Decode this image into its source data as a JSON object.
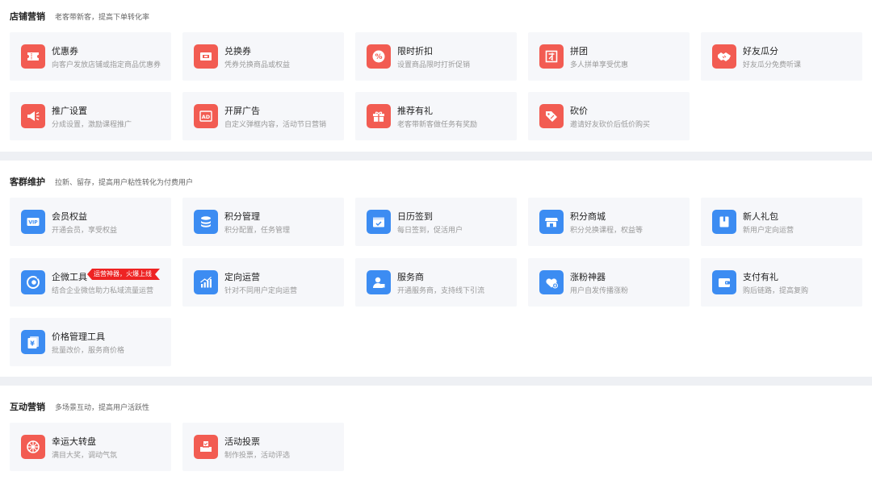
{
  "sections": [
    {
      "title": "店铺营销",
      "desc": "老客带新客，提高下单转化率",
      "cards": [
        {
          "title": "优惠券",
          "desc": "向客户发放店铺或指定商品优惠券",
          "icon": "coupon-icon",
          "color": "#f25c52"
        },
        {
          "title": "兑换券",
          "desc": "凭券兑换商品或权益",
          "icon": "exchange-ticket-icon",
          "color": "#f25c52"
        },
        {
          "title": "限时折扣",
          "desc": "设置商品限时打折促销",
          "icon": "percent-discount-icon",
          "color": "#f25c52"
        },
        {
          "title": "拼团",
          "desc": "多人拼单享受优惠",
          "icon": "group-buy-icon",
          "color": "#f25c52"
        },
        {
          "title": "好友瓜分",
          "desc": "好友瓜分免费听课",
          "icon": "handshake-icon",
          "color": "#f25c52"
        },
        {
          "title": "推广设置",
          "desc": "分成设置，激励课程推广",
          "icon": "megaphone-icon",
          "color": "#f25c52"
        },
        {
          "title": "开屏广告",
          "desc": "自定义弹框内容，活动节日营销",
          "icon": "ad-icon",
          "color": "#f25c52"
        },
        {
          "title": "推荐有礼",
          "desc": "老客带新客做任务有奖励",
          "icon": "gift-icon",
          "color": "#f25c52"
        },
        {
          "title": "砍价",
          "desc": "邀请好友砍价后低价购买",
          "icon": "price-tag-icon",
          "color": "#f25c52"
        }
      ]
    },
    {
      "title": "客群维护",
      "desc": "拉新、留存，提高用户粘性转化为付费用户",
      "cards": [
        {
          "title": "会员权益",
          "desc": "开通会员，享受权益",
          "icon": "vip-card-icon",
          "color": "#3c8cf2"
        },
        {
          "title": "积分管理",
          "desc": "积分配置，任务管理",
          "icon": "coin-stack-icon",
          "color": "#3c8cf2"
        },
        {
          "title": "日历签到",
          "desc": "每日签到，促活用户",
          "icon": "calendar-check-icon",
          "color": "#3c8cf2"
        },
        {
          "title": "积分商城",
          "desc": "积分兑换课程，权益等",
          "icon": "store-icon",
          "color": "#3c8cf2"
        },
        {
          "title": "新人礼包",
          "desc": "新用户定向运营",
          "icon": "gift-pack-icon",
          "color": "#3c8cf2"
        },
        {
          "title": "企微工具",
          "desc": "结合企业微信助力私域流量运营",
          "icon": "wecom-icon",
          "color": "#3c8cf2",
          "badge": "运营神器，火爆上线"
        },
        {
          "title": "定向运营",
          "desc": "针对不同用户定向运营",
          "icon": "growth-chart-icon",
          "color": "#3c8cf2"
        },
        {
          "title": "服务商",
          "desc": "开通服务商，支持线下引流",
          "icon": "service-person-icon",
          "color": "#3c8cf2"
        },
        {
          "title": "涨粉神器",
          "desc": "用户自发传播涨粉",
          "icon": "heart-plus-icon",
          "color": "#3c8cf2"
        },
        {
          "title": "支付有礼",
          "desc": "购后链路，提高复购",
          "icon": "wallet-icon",
          "color": "#3c8cf2"
        },
        {
          "title": "价格管理工具",
          "desc": "批量改价，服务商价格",
          "icon": "yuan-document-icon",
          "color": "#3c8cf2"
        }
      ]
    },
    {
      "title": "互动营销",
      "desc": "多场景互动，提高用户活跃性",
      "cards": [
        {
          "title": "幸运大转盘",
          "desc": "满目大奖，调动气氛",
          "icon": "lucky-wheel-icon",
          "color": "#f25c52"
        },
        {
          "title": "活动投票",
          "desc": "制作投票，活动评选",
          "icon": "ballot-box-icon",
          "color": "#f25c52"
        }
      ]
    }
  ]
}
